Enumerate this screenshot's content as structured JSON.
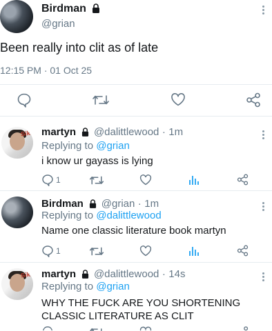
{
  "main_tweet": {
    "author_name": "Birdman",
    "author_handle": "@grian",
    "text": "Been really into clit as of late",
    "timestamp": "12:15 PM · 01 Oct 25"
  },
  "replies": [
    {
      "author_name": "martyn",
      "author_handle": "@dalittlewood",
      "time": "1m",
      "replying_to_label": "Replying to",
      "replying_to": "@grian",
      "text": "i know ur gayass is lying",
      "reply_count": "1",
      "avatar_label": "Sikuk"
    },
    {
      "author_name": "Birdman",
      "author_handle": "@grian",
      "time": "1m",
      "replying_to_label": "Replying to",
      "replying_to": "@dalittlewood",
      "text": "Name one classic literature book martyn",
      "reply_count": "1"
    },
    {
      "author_name": "martyn",
      "author_handle": "@dalittlewood",
      "time": "14s",
      "replying_to_label": "Replying to",
      "replying_to": "@grian",
      "text": "WHY THE FUCK ARE YOU SHORTENING CLASSIC LITERATURE AS CLIT",
      "avatar_label": "Sikuk"
    }
  ],
  "icons": [
    "lock-icon",
    "more-icon",
    "reply-icon",
    "retweet-icon",
    "like-icon",
    "share-icon",
    "analytics-icon"
  ],
  "colors": {
    "link": "#1da1f2",
    "secondary": "#657786",
    "divider": "#e6ecf0",
    "icon": "#8899a6"
  }
}
